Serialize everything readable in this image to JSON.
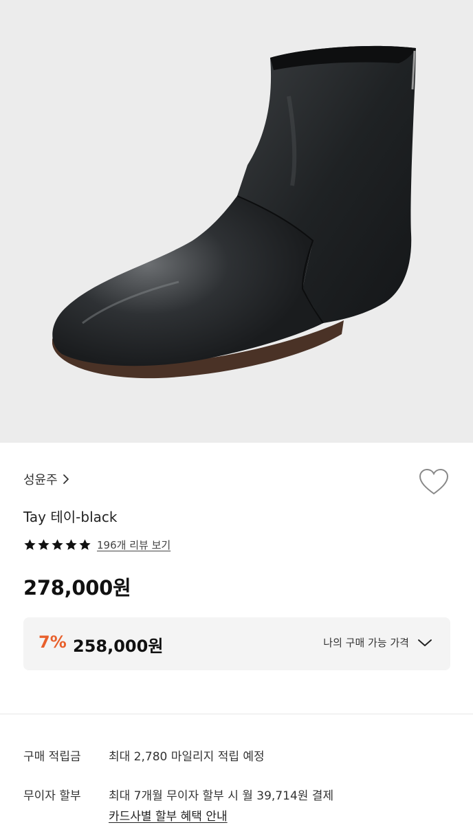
{
  "product": {
    "image_alt": "black leather ankle boot",
    "brand": "성윤주",
    "title": "Tay 테이-black",
    "rating_stars": 5,
    "review_link": "196개 리뷰 보기",
    "price": "278,000원",
    "discount_rate": "7%",
    "discount_price": "258,000원",
    "my_price_label": "나의 구매 가능 가격"
  },
  "benefits": {
    "points_label": "구매 적립금",
    "points_value": "최대 2,780 마일리지 적립 예정",
    "installment_label": "무이자 할부",
    "installment_value": "최대 7개월 무이자 할부 시 월 39,714원 결제",
    "card_link": "카드사별 할부 혜택 안내"
  },
  "colors": {
    "discount": "#e8602c",
    "hero_bg": "#ececec",
    "box_bg": "#f4f4f4"
  },
  "icons": {
    "brand_chevron": "chevron-right-icon",
    "wishlist": "heart-icon",
    "star": "star-icon",
    "expand": "chevron-down-icon"
  }
}
